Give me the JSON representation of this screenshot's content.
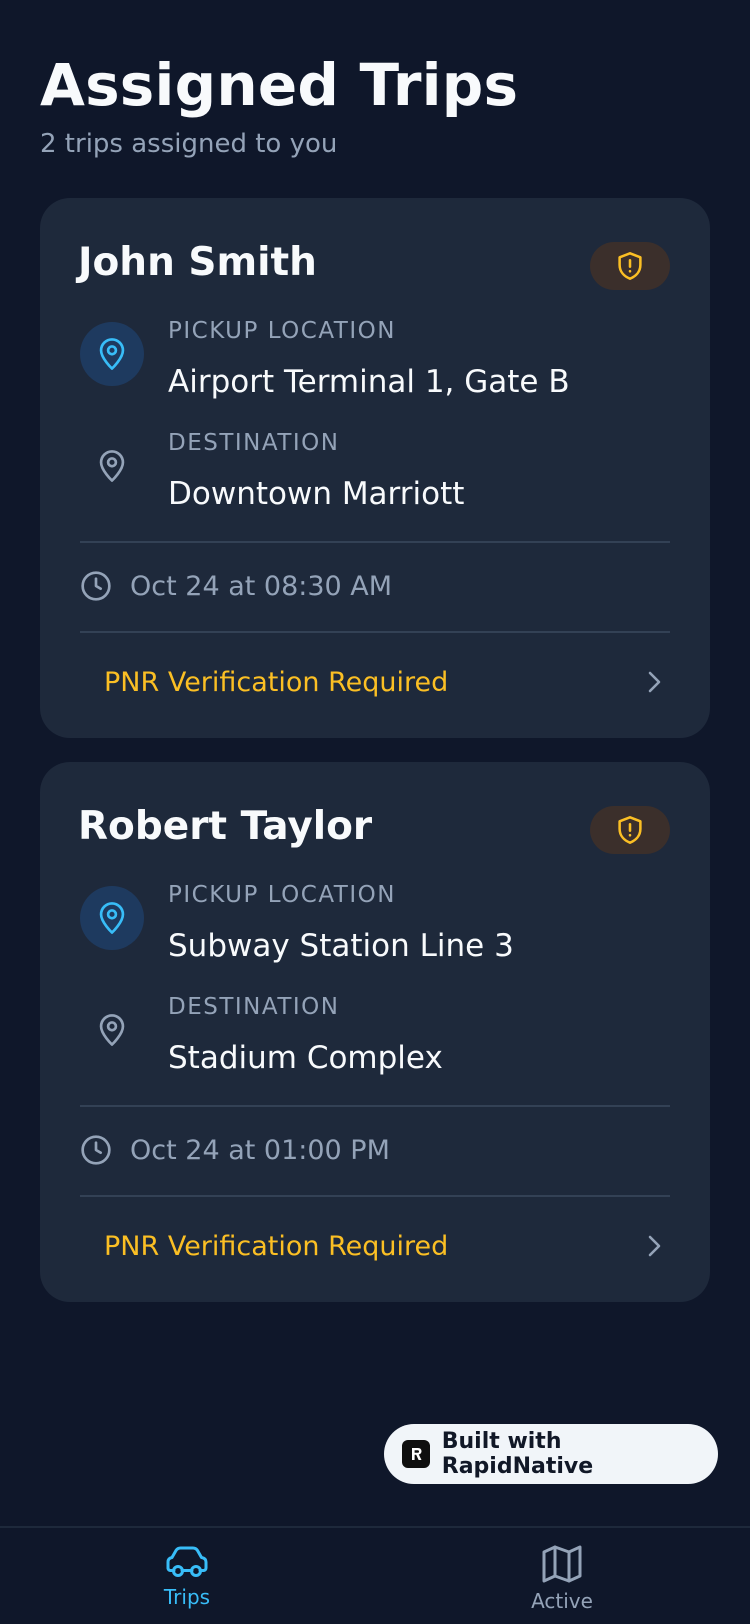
{
  "header": {
    "title": "Assigned Trips",
    "subtitle": "2 trips assigned to you"
  },
  "trips": [
    {
      "passenger": "John Smith",
      "pickup_label": "PICKUP LOCATION",
      "pickup": "Airport Terminal 1, Gate B",
      "destination_label": "DESTINATION",
      "destination": "Downtown Marriott",
      "time": "Oct 24 at 08:30 AM",
      "action": "PNR Verification Required",
      "badge_icon": "shield-alert-icon"
    },
    {
      "passenger": "Robert Taylor",
      "pickup_label": "PICKUP LOCATION",
      "pickup": "Subway Station Line 3",
      "destination_label": "DESTINATION",
      "destination": "Stadium Complex",
      "time": "Oct 24 at 01:00 PM",
      "action": "PNR Verification Required",
      "badge_icon": "shield-alert-icon"
    }
  ],
  "watermark": {
    "label": "Built with RapidNative"
  },
  "tabs": [
    {
      "label": "Trips",
      "icon": "car-icon",
      "selected": true
    },
    {
      "label": "Active",
      "icon": "map-icon",
      "selected": false
    }
  ],
  "colors": {
    "background": "#0f172a",
    "card": "#1e293b",
    "accent": "#38bdf8",
    "warning": "#fbbf24",
    "muted": "#94a3b8"
  }
}
